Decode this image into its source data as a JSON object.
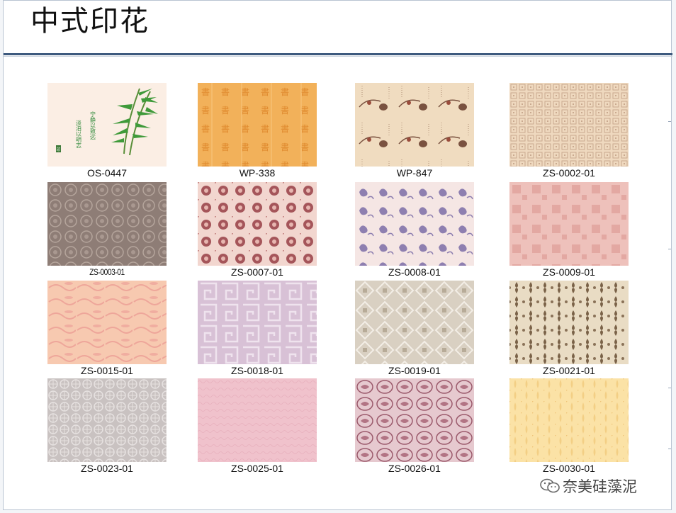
{
  "title": "中式印花",
  "watermark": "奈美硅藻泥",
  "swatch_text": {
    "poem_left": "淡泊以明志",
    "poem_right": "宁静以致远",
    "seal": "印"
  },
  "items": [
    {
      "code": "OS-0447"
    },
    {
      "code": "WP-338"
    },
    {
      "code": "WP-847"
    },
    {
      "code": "ZS-0002-01"
    },
    {
      "code": "ZS-0003-01"
    },
    {
      "code": "ZS-0007-01"
    },
    {
      "code": "ZS-0008-01"
    },
    {
      "code": "ZS-0009-01"
    },
    {
      "code": "ZS-0015-01"
    },
    {
      "code": "ZS-0018-01"
    },
    {
      "code": "ZS-0019-01"
    },
    {
      "code": "ZS-0021-01"
    },
    {
      "code": "ZS-0023-01"
    },
    {
      "code": "ZS-0025-01"
    },
    {
      "code": "ZS-0026-01"
    },
    {
      "code": "ZS-0030-01"
    }
  ],
  "colors": {
    "title_rule": "#3e5a7e",
    "bamboo": "#3f9a3a",
    "wp338": "#f2b15a",
    "wp847": "#f0dcc0",
    "zs0002": "#efd9bf",
    "zs0003": "#8e7d76",
    "zs0007": "#f2d6cf",
    "zs0008": "#f5e6e4",
    "zs0009": "#eec1bb",
    "zs0015": "#f7c9b0",
    "zs0018": "#d8c1d6",
    "zs0019": "#d9d0c2",
    "zs0021": "#e9dcc4",
    "zs0023": "#c9c2c1",
    "zs0025": "#f0c2cc",
    "zs0026": "#e6c9cf",
    "zs0030": "#fbe2a6"
  }
}
